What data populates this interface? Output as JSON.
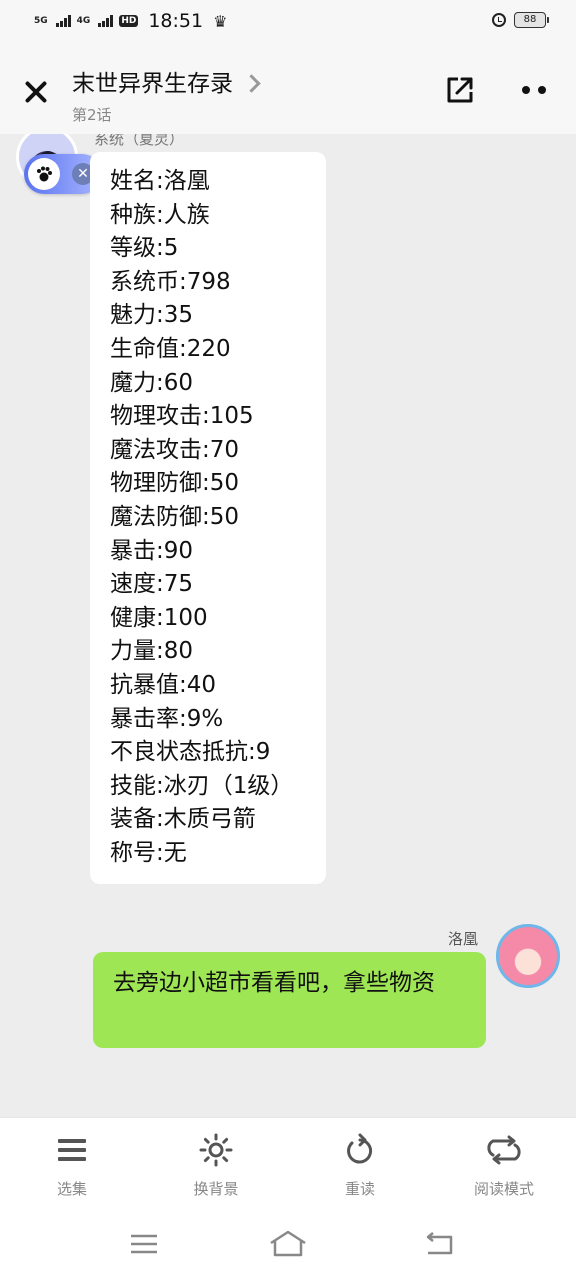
{
  "status_bar": {
    "sig1": "5G",
    "sig2": "4G",
    "hd": "HD",
    "time": "18:51",
    "battery": "88"
  },
  "header": {
    "title": "末世异界生存录",
    "subtitle": "第2话"
  },
  "chat": {
    "system_name": "系统（夏灵）",
    "stats": [
      "姓名:洛凰",
      "种族:人族",
      "等级:5",
      "系统币:798",
      "魅力:35",
      "生命值:220",
      "魔力:60",
      "物理攻击:105",
      "魔法攻击:70",
      "物理防御:50",
      "魔法防御:50",
      "暴击:90",
      "速度:75",
      "健康:100",
      "力量:80",
      "抗暴值:40",
      "暴击率:9%",
      "不良状态抵抗:9",
      "技能:冰刃（1级）",
      "装备:木质弓箭",
      "称号:无"
    ],
    "user_name": "洛凰",
    "user_message": "去旁边小超市看看吧，拿些物资"
  },
  "toolbar": {
    "items": [
      {
        "label": "选集",
        "icon": "list-icon"
      },
      {
        "label": "换背景",
        "icon": "sun-icon"
      },
      {
        "label": "重读",
        "icon": "refresh-icon"
      },
      {
        "label": "阅读模式",
        "icon": "loop-icon"
      }
    ]
  },
  "colors": {
    "user_bubble": "#9ee654",
    "system_bubble": "#ffffff",
    "background": "#ededed"
  }
}
